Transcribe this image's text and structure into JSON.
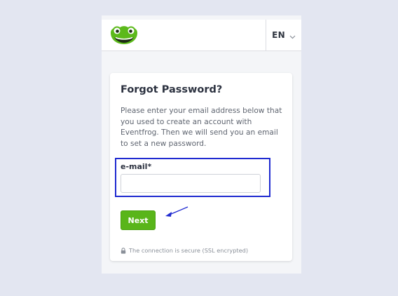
{
  "header": {
    "logo_icon": "frog-logo-icon",
    "language": {
      "label": "EN",
      "icon": "chevron-down-icon"
    }
  },
  "form": {
    "title": "Forgot Password?",
    "description": "Please enter your email address below that you used to create an account with Eventfrog. Then we will send you an email to set a new password.",
    "email": {
      "label": "e-mail*",
      "value": "",
      "placeholder": ""
    },
    "submit_label": "Next",
    "security_note": "The connection is secure (SSL encrypted)",
    "security_icon": "lock-icon"
  },
  "colors": {
    "background": "#e3e6f1",
    "brand_green": "#59b51a",
    "highlight_blue": "#1f2ad0"
  }
}
